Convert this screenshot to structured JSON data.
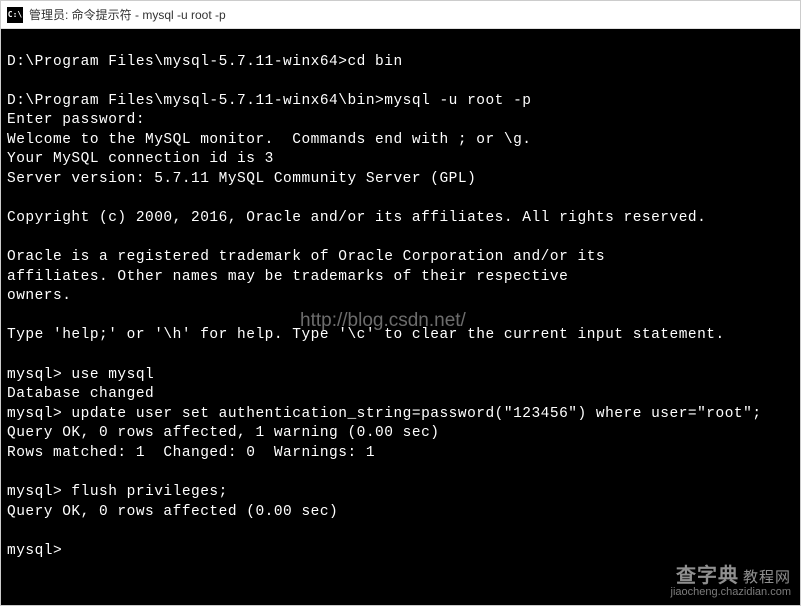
{
  "window": {
    "title": "管理员: 命令提示符 - mysql  -u root -p",
    "icon_text": "C:\\"
  },
  "terminal": {
    "lines": [
      "",
      "D:\\Program Files\\mysql-5.7.11-winx64>cd bin",
      "",
      "D:\\Program Files\\mysql-5.7.11-winx64\\bin>mysql -u root -p",
      "Enter password:",
      "Welcome to the MySQL monitor.  Commands end with ; or \\g.",
      "Your MySQL connection id is 3",
      "Server version: 5.7.11 MySQL Community Server (GPL)",
      "",
      "Copyright (c) 2000, 2016, Oracle and/or its affiliates. All rights reserved.",
      "",
      "Oracle is a registered trademark of Oracle Corporation and/or its",
      "affiliates. Other names may be trademarks of their respective",
      "owners.",
      "",
      "Type 'help;' or '\\h' for help. Type '\\c' to clear the current input statement.",
      "",
      "mysql> use mysql",
      "Database changed",
      "mysql> update user set authentication_string=password(\"123456\") where user=\"root\";",
      "Query OK, 0 rows affected, 1 warning (0.00 sec)",
      "Rows matched: 1  Changed: 0  Warnings: 1",
      "",
      "mysql> flush privileges;",
      "Query OK, 0 rows affected (0.00 sec)",
      "",
      "mysql>"
    ]
  },
  "watermarks": {
    "center": "http://blog.csdn.net/",
    "footer_main": "查字典",
    "footer_suffix": "教程网",
    "footer_url": "jiaocheng.chazidian.com"
  }
}
